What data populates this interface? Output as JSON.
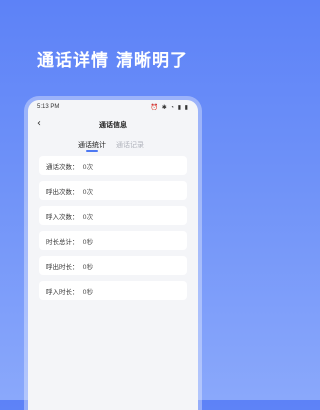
{
  "headline": "通话详情 清晰明了",
  "status_bar": {
    "time": "5:13 PM",
    "icons": "⏰ ✱ ◔ ▮ ▮"
  },
  "nav": {
    "back_icon": "‹",
    "title": "通话信息"
  },
  "tabs": [
    {
      "label": "通话统计",
      "active": true
    },
    {
      "label": "通话记录",
      "active": false
    }
  ],
  "stats": [
    {
      "label": "通话次数：",
      "value": "0次"
    },
    {
      "label": "呼出次数：",
      "value": "0次"
    },
    {
      "label": "呼入次数：",
      "value": "0次"
    },
    {
      "label": "时长总计：",
      "value": "0秒"
    },
    {
      "label": "呼出时长：",
      "value": "0秒"
    },
    {
      "label": "呼入时长：",
      "value": "0秒"
    }
  ],
  "colors": {
    "accent": "#4d78f2",
    "background": "#6f92f8"
  }
}
